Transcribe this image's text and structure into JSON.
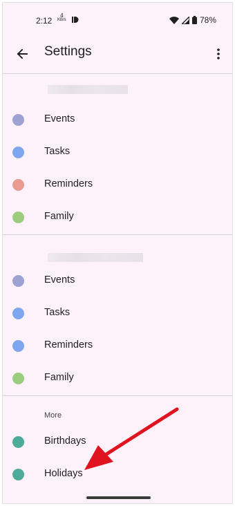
{
  "status_bar": {
    "time": "2:12",
    "speed_value": "4",
    "speed_unit": "KB/s",
    "battery": "78%",
    "icons": [
      "data-saver-icon",
      "wifi-icon",
      "signal-icon",
      "battery-icon"
    ]
  },
  "app_bar": {
    "title": "Settings",
    "back_icon": "arrow-back-icon",
    "more_icon": "more-vert-icon"
  },
  "account_sections": [
    {
      "account_name": "",
      "calendars": [
        {
          "label": "Events",
          "color": "#9ea2d3"
        },
        {
          "label": "Tasks",
          "color": "#7ea6ef"
        },
        {
          "label": "Reminders",
          "color": "#ea9a90"
        },
        {
          "label": "Family",
          "color": "#9ccd7e"
        }
      ]
    },
    {
      "account_name": "",
      "calendars": [
        {
          "label": "Events",
          "color": "#9ea2d3"
        },
        {
          "label": "Tasks",
          "color": "#7ea6ef"
        },
        {
          "label": "Reminders",
          "color": "#7ea6ef"
        },
        {
          "label": "Family",
          "color": "#9ccd7e"
        }
      ]
    }
  ],
  "more_section": {
    "heading": "More",
    "calendars": [
      {
        "label": "Birthdays",
        "color": "#4eaa99"
      },
      {
        "label": "Holidays",
        "color": "#4eaa99"
      }
    ]
  },
  "annotation": {
    "type": "red-arrow",
    "color": "#e0141f",
    "points_to": "Holidays"
  }
}
